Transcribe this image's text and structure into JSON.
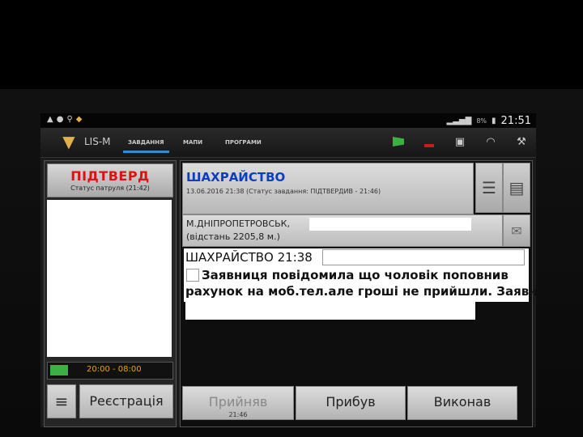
{
  "status_bar": {
    "time": "21:51",
    "battery_text": "8%",
    "left_icons": [
      "warning-icon",
      "location-icon",
      "search-icon",
      "app-notification-icon"
    ],
    "right_icons": [
      "signal-icon",
      "battery-icon"
    ]
  },
  "app_bar": {
    "app_name": "LIS-M",
    "tabs": [
      {
        "label": "ЗАВДАННЯ",
        "active": true
      },
      {
        "label": "МАПИ",
        "active": false
      },
      {
        "label": "ПРОГРАМИ",
        "active": false
      }
    ],
    "icons": [
      "green-flag-icon",
      "red-flag-icon",
      "screen-icon",
      "wifi-icon",
      "wrench-icon"
    ]
  },
  "left_panel": {
    "status_title": "ПІДТВЕРД",
    "status_subtitle": "Статус патруля (21:42)",
    "shift_hours": "20:00 - 08:00",
    "menu_icon": "≡",
    "register_button": "Реєстрація"
  },
  "task": {
    "title": "ШАХРАЙСТВО",
    "subtitle": "13.06.2016 21:38 (Статус завдання: ПІДТВЕРДИВ - 21:46)",
    "address_city": "М.ДНІПРОПЕТРОВСЬК,",
    "address_distance": "(відстань 2205,8 м.)",
    "detail_heading": "ШАХРАЙСТВО 21:38",
    "detail_line2": "Заявниця повідомила що чоловік поповнив",
    "detail_line3": "рахунок на моб.тел.але гроші не прийшли. Заявник"
  },
  "actions": {
    "accept": "Прийняв",
    "accept_time": "21:46",
    "arrived": "Прибув",
    "completed": "Виконав"
  },
  "colors": {
    "status_red": "#d11111",
    "title_blue": "#0b3fbf",
    "shift_amber": "#e8a317",
    "indicator_green": "#3cb043",
    "tab_underline": "#2b8fd6"
  }
}
